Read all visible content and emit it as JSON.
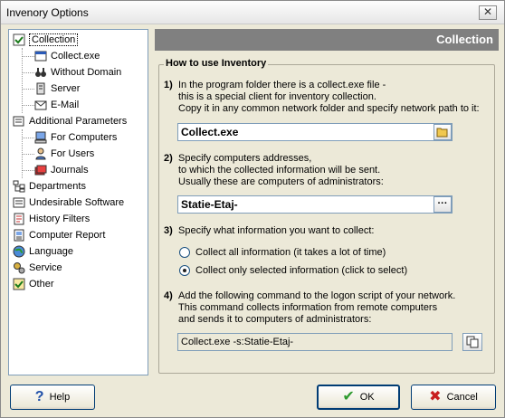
{
  "window": {
    "title": "Invenory Options",
    "close_glyph": "✕"
  },
  "tree": {
    "items": [
      {
        "label": "Collection",
        "icon": "checkbox-icon"
      },
      {
        "label": "Collect.exe",
        "icon": "window-icon"
      },
      {
        "label": "Without Domain",
        "icon": "binoculars-icon"
      },
      {
        "label": "Server",
        "icon": "server-icon"
      },
      {
        "label": "E-Mail",
        "icon": "email-icon"
      },
      {
        "label": "Additional Parameters",
        "icon": "parameters-icon"
      },
      {
        "label": "For Computers",
        "icon": "computer-icon"
      },
      {
        "label": "For Users",
        "icon": "user-icon"
      },
      {
        "label": "Journals",
        "icon": "journals-icon"
      },
      {
        "label": "Departments",
        "icon": "departments-icon"
      },
      {
        "label": "Undesirable Software",
        "icon": "undesirable-software-icon"
      },
      {
        "label": "History Filters",
        "icon": "history-icon"
      },
      {
        "label": "Computer Report",
        "icon": "report-icon"
      },
      {
        "label": "Language",
        "icon": "globe-icon"
      },
      {
        "label": "Service",
        "icon": "gears-icon"
      },
      {
        "label": "Other",
        "icon": "checkbox-icon"
      }
    ]
  },
  "header": {
    "title": "Collection"
  },
  "group": {
    "title": "How to use Inventory"
  },
  "steps": {
    "s1": {
      "num": "1)",
      "line1": "In the program folder there is a collect.exe file -",
      "line2": "this is a special client for inventory collection.",
      "line3": "Copy it in any common network folder and specify network path to it:",
      "value": "Collect.exe"
    },
    "s2": {
      "num": "2)",
      "line1": "Specify computers addresses,",
      "line2": "to which the collected information will be sent.",
      "line3": "Usually these are computers of administrators:",
      "value": "Statie-Etaj-",
      "browse": "···"
    },
    "s3": {
      "num": "3)",
      "line1": "Specify what information you want to collect:",
      "opt_all": "Collect all information (it takes a lot of time)",
      "opt_selected": "Collect only selected information (click to select)"
    },
    "s4": {
      "num": "4)",
      "line1": "Add the following command to the logon script of your network.",
      "line2": "This command collects information from remote computers",
      "line3": "and sends it to computers of administrators:",
      "command": "Collect.exe -s:Statie-Etaj-"
    }
  },
  "buttons": {
    "help": "Help",
    "help_glyph": "?",
    "ok": "OK",
    "ok_glyph": "✔",
    "cancel": "Cancel",
    "cancel_glyph": "✖"
  },
  "colors": {
    "header_bg": "#808080",
    "ok_check": "#2e9a2e",
    "cancel_x": "#c81e1e",
    "help_q": "#1f4fa8"
  }
}
